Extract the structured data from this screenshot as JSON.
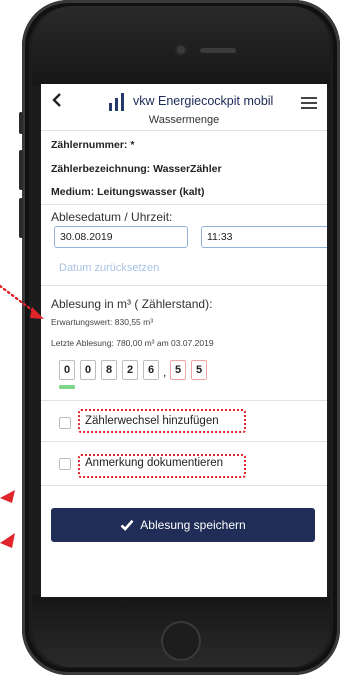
{
  "app": {
    "title": "vkw Energiecockpit mobil",
    "subtitle": "Wassermenge"
  },
  "icons": {
    "back": "back-chevron-icon",
    "logo": "vkw-logo-icon",
    "menu": "hamburger-menu-icon",
    "save": "checkmark-icon"
  },
  "meter": {
    "number_label": "Zählernummer: *",
    "designation_label": "Zählerbezeichnung: WasserZähler",
    "medium_label": "Medium: Leitungswasser (kalt)"
  },
  "reading_date": {
    "label": "Ablesedatum / Uhrzeit:",
    "date_value": "30.08.2019",
    "time_value": "11:33",
    "reset_link": "Datum zurücksetzen"
  },
  "reading": {
    "label": "Ablesung in m³ ( Zählerstand):",
    "expected": "Erwartungswert: 830,55 m³",
    "last": "Letzte Ablesung: 780,00 m³ am 03.07.2019",
    "digits": [
      "0",
      "0",
      "8",
      "2",
      "6",
      "5",
      "5"
    ],
    "comma": ","
  },
  "options": {
    "meter_change": "Zählerwechsel hinzufügen",
    "annotation": "Anmerkung dokumentieren"
  },
  "save_button": {
    "label": "Ablesung speichern"
  },
  "colors": {
    "primary": "#1f2d57",
    "field_border": "#93b2d9",
    "link": "#a9c2e3",
    "highlight": "#e0242b",
    "active_digit": "#7fd58a"
  }
}
